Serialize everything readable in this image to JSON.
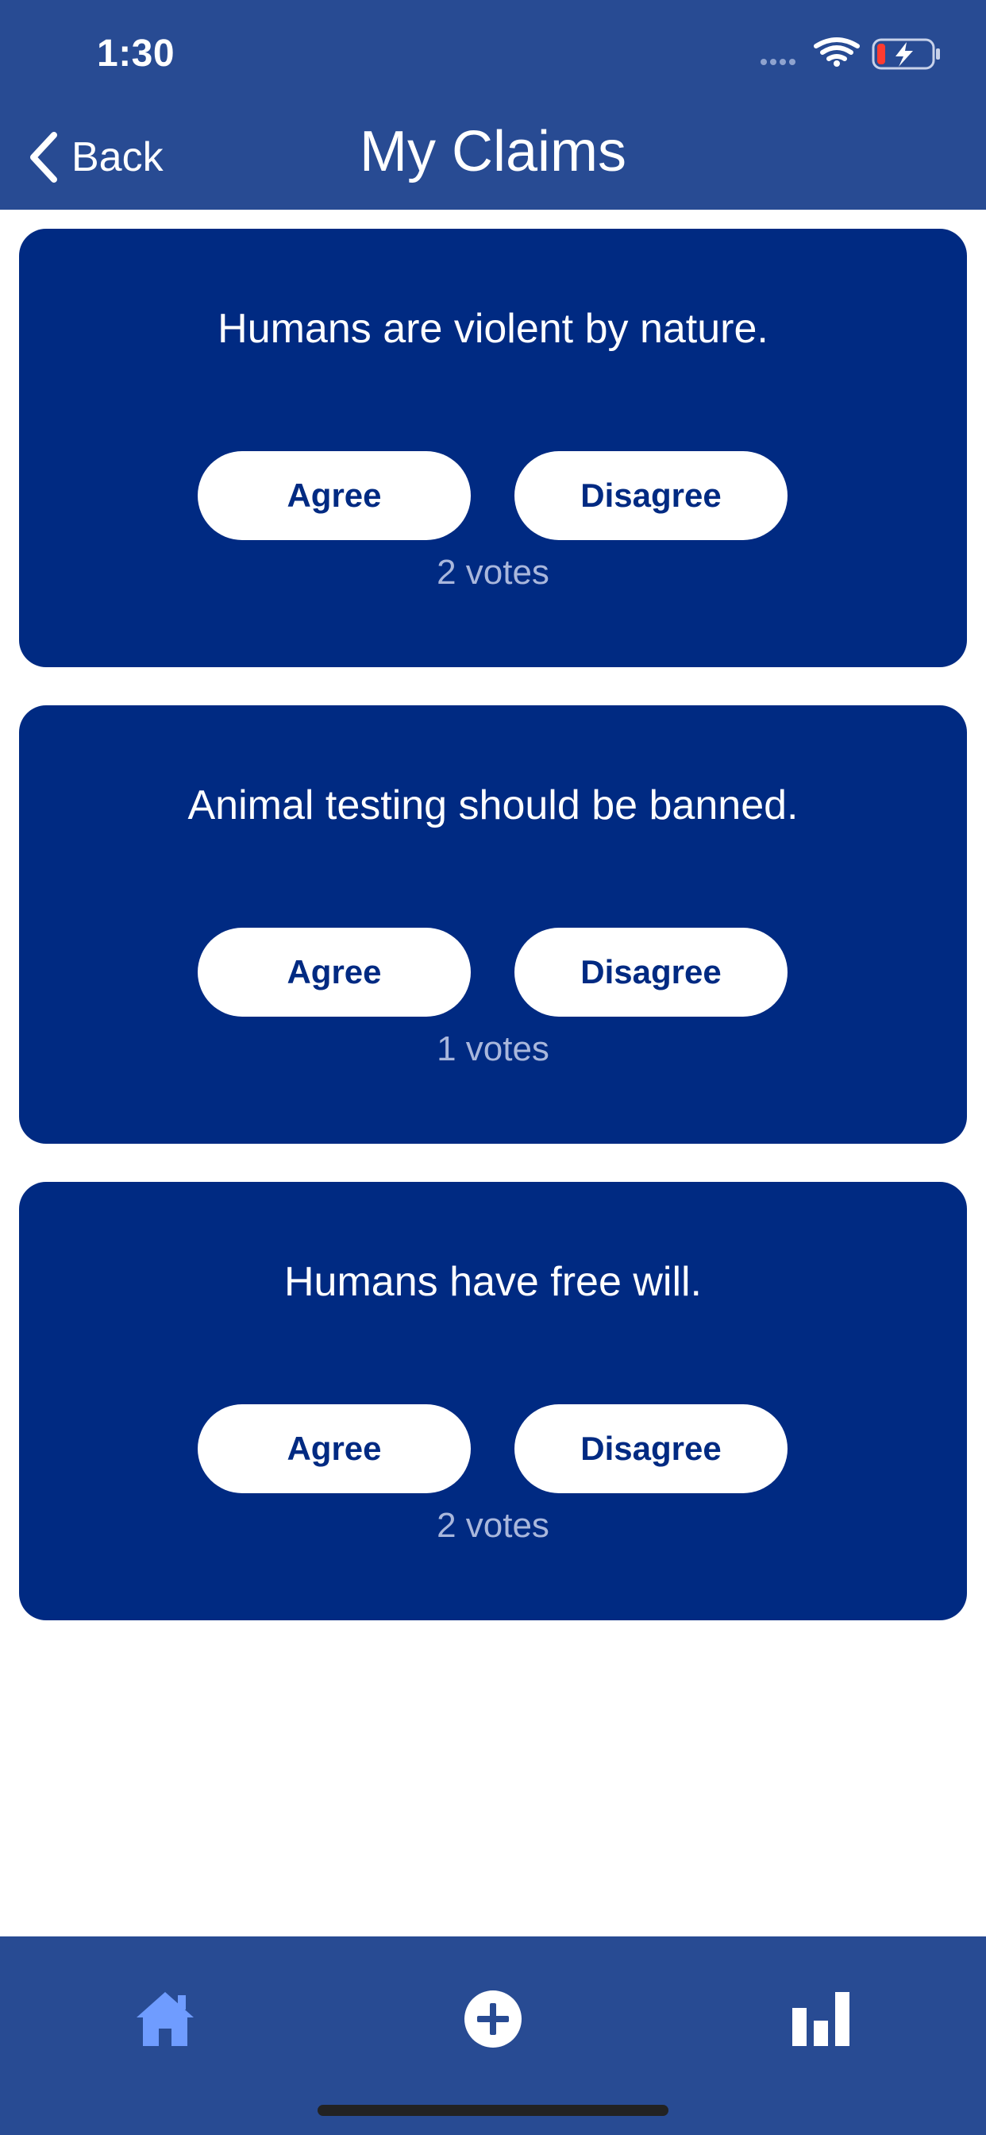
{
  "status_bar": {
    "time": "1:30",
    "icons": [
      "signal-dots-icon",
      "wifi-icon",
      "battery-charging-icon"
    ]
  },
  "nav": {
    "back_label": "Back",
    "title": "My Claims"
  },
  "claims": [
    {
      "text": "Humans are violent by nature.",
      "agree_label": "Agree",
      "disagree_label": "Disagree",
      "votes": "2 votes"
    },
    {
      "text": "Animal testing should be banned.",
      "agree_label": "Agree",
      "disagree_label": "Disagree",
      "votes": "1 votes"
    },
    {
      "text": "Humans have free will.",
      "agree_label": "Agree",
      "disagree_label": "Disagree",
      "votes": "2 votes"
    }
  ],
  "tab_bar": {
    "tabs": [
      {
        "icon": "home-icon",
        "active": true
      },
      {
        "icon": "add-circle-icon",
        "active": false
      },
      {
        "icon": "bar-chart-icon",
        "active": false
      }
    ]
  },
  "colors": {
    "header_bg": "#284b93",
    "card_bg": "#002a82",
    "button_bg": "#ffffff",
    "button_text": "#002a82",
    "votes_text": "#a9b7dc",
    "active_tab": "#6f9cff",
    "inactive_tab": "#ffffff"
  }
}
